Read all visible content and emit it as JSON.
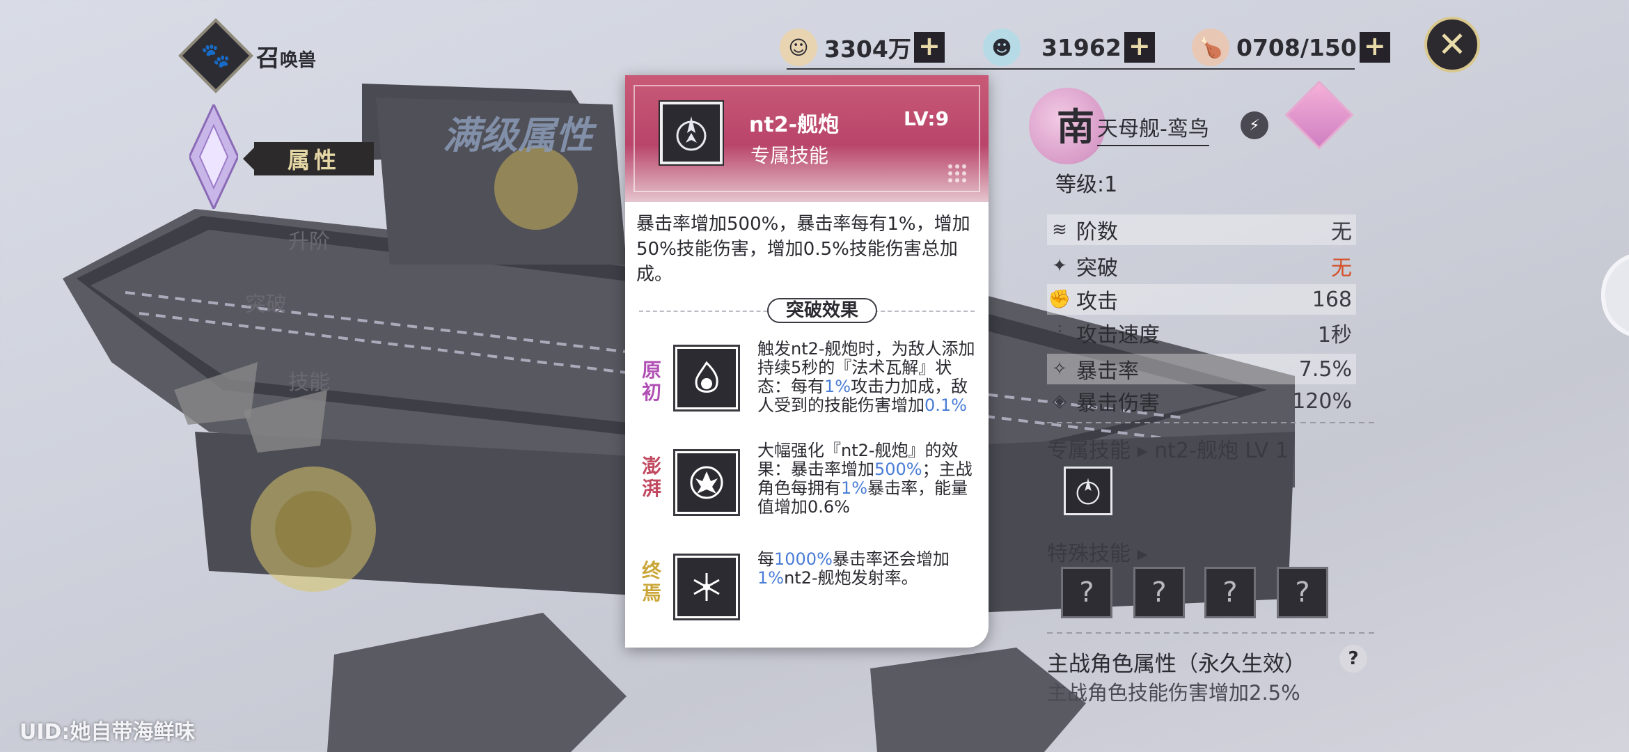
{
  "header": {
    "title_main": "召",
    "title_sub": "唤兽",
    "emblem_icon": "paw-icon"
  },
  "currencies": [
    {
      "icon": "smiley-coin-icon",
      "value": "3304万",
      "color": "#e8d4b0"
    },
    {
      "icon": "blue-slime-icon",
      "value": "31962",
      "color": "#b7dbe6"
    },
    {
      "icon": "drumstick-icon",
      "value": "0708/150",
      "color": "#e8c7b5"
    }
  ],
  "left_menu": {
    "attributes": "属性",
    "advance": "升阶",
    "breakthrough": "突破",
    "skill": "技能"
  },
  "max_attr_watermark": "满级属性",
  "uid": "UID:她自带海鲜味",
  "popup": {
    "skill_name": "nt2-舰炮",
    "level": "LV:9",
    "subtitle": "专属技能",
    "description": "暴击率增加500%，暴击率每有1%，增加50%技能伤害，增加0.5%技能伤害总加成。",
    "breakthrough_label": "突破效果",
    "tiers": [
      {
        "badge": "原初",
        "badge_color": "#b04fb4",
        "icon": "flame-skull-icon",
        "text_a": "触发nt2-舰炮时，为敌人添加持续5秒的『法术瓦解』状态：每有",
        "hl1": "1%",
        "text_b": "攻击力加成，敌人受到的技能伤害增加",
        "hl2": "0.1%",
        "text_c": ""
      },
      {
        "badge": "澎湃",
        "badge_color": "#c0485f",
        "icon": "fire-burst-icon",
        "text_a": "大幅强化『nt2-舰炮』的效果：暴击率增加",
        "hl1": "500%",
        "text_b": "；主战角色每拥有",
        "hl2": "1%",
        "text_c": "暴击率，能量值增加0.6%"
      },
      {
        "badge": "终焉",
        "badge_color": "#c9a637",
        "icon": "snowflake-icon",
        "text_a": "每",
        "hl1": "1000%",
        "text_b": "暴击率还会增加",
        "hl2": "1%",
        "text_c": "nt2-舰炮发射率。"
      }
    ]
  },
  "right_panel": {
    "grade_char": "南",
    "ship_name": "天母舰-鸾鸟",
    "level": "等级:1",
    "stats": [
      {
        "icon": "layers-icon",
        "label": "阶数",
        "value": "无",
        "red": false
      },
      {
        "icon": "star-badge-icon",
        "label": "突破",
        "value": "无",
        "red": true
      },
      {
        "icon": "fist-icon",
        "label": "攻击",
        "value": "168",
        "red": false
      },
      {
        "icon": "speed-icon",
        "label": "攻击速度",
        "value": "1秒",
        "red": false
      },
      {
        "icon": "crit-icon",
        "label": "暴击率",
        "value": "7.5%",
        "red": false
      },
      {
        "icon": "crit-dmg-icon",
        "label": "暴击伤害",
        "value": "120%",
        "red": false
      }
    ],
    "exclusive_skill_label": "专属技能 ▸ nt2-舰炮 LV 1",
    "special_skill_label": "特殊技能 ▸",
    "special_slots": [
      "?",
      "?",
      "?",
      "?"
    ],
    "main_attr_label": "主战角色属性（永久生效）",
    "main_attr_desc": "主战角色技能伤害增加2.5%",
    "help": "?"
  }
}
